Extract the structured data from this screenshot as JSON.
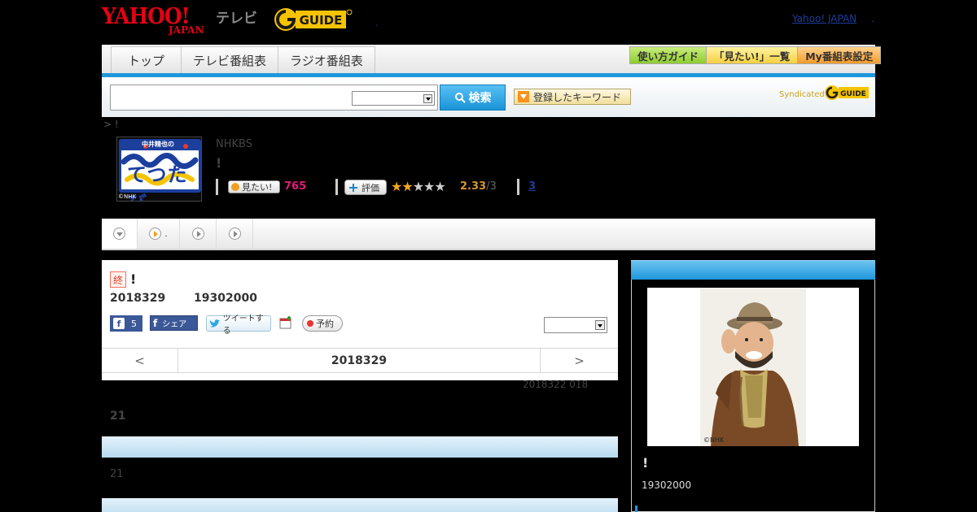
{
  "header": {
    "logo_yahoo_main": "YAHOO!",
    "logo_yahoo_sub": "JAPAN",
    "logo_tv": "テレビ",
    "logo_gguide": "G GUIDE",
    "dot": ".",
    "yahoo_link": "Yahoo! JAPAN",
    "yahoo_link_dot": "."
  },
  "nav": {
    "tabs": [
      "トップ",
      "テレビ番組表",
      "ラジオ番組表"
    ],
    "util_buttons": [
      "使い方ガイド",
      "「見たい!」一覧",
      "My番組表設定"
    ]
  },
  "search": {
    "input_value": "",
    "select_value": "",
    "button_label": "検索",
    "keyword_button": "登録したキーワード",
    "syndicated": "Syndicated",
    "syn_logo": "G GUIDE"
  },
  "breadcrumb": "> !",
  "program": {
    "channel": "NHKBS",
    "title": "!",
    "thumb_caption": "©NHK",
    "thumb_title": "中井精也の",
    "thumb_main": "てつたび",
    "want_label": "見たい!",
    "want_count": "765",
    "rate_label": "評価",
    "stars_on": 2,
    "stars_total": 5,
    "rating": "2.33",
    "rating_of": "/3",
    "reviews": "3"
  },
  "subtabs": {
    "tab2_text": "."
  },
  "episode": {
    "end_badge": "終",
    "title": "!",
    "date": "2018329",
    "time": "19302000",
    "fb_like_count": "5",
    "fb_share": "シェア",
    "tweet": "ツイートする",
    "reserve": "予約",
    "select_value": "",
    "nav_prev": "<",
    "nav_date": "2018329",
    "nav_next": ">",
    "prev_air": "2018322  018",
    "section1_num": "21",
    "section2_num": "21"
  },
  "right": {
    "photo_caption": "©NHK",
    "guest_name": "!",
    "guest_time": "19302000"
  },
  "colors": {
    "accent_blue": "#1e96dc",
    "yahoo_red": "#e60013",
    "want_pink": "#e6197a",
    "star_gold": "#f2a81c"
  }
}
